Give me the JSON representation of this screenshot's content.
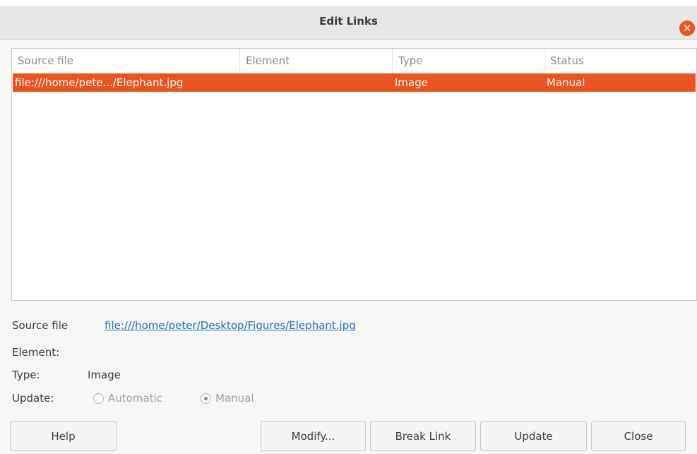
{
  "dialog": {
    "title": "Edit Links"
  },
  "table": {
    "headers": [
      "Source file",
      "Element",
      "Type",
      "Status"
    ],
    "rows": [
      {
        "source": "file:///home/pete.../Elephant.jpg",
        "element": "",
        "type": "Image",
        "status": "Manual"
      }
    ]
  },
  "details": {
    "source_label": "Source file",
    "source_value": "file:///home/peter/Desktop/Figures/Elephant.jpg",
    "element_label": "Element:",
    "type_label": "Type:",
    "type_value": "Image",
    "update_label": "Update:",
    "update_options": [
      "Automatic",
      "Manual"
    ],
    "update_selected": "Manual"
  },
  "buttons": {
    "help": "Help",
    "modify": "Modify...",
    "break_link": "Break Link",
    "update": "Update",
    "close": "Close"
  },
  "colors": {
    "accent": "#e95420",
    "link": "#1a73b8"
  },
  "icons": {
    "close": "close-icon"
  }
}
